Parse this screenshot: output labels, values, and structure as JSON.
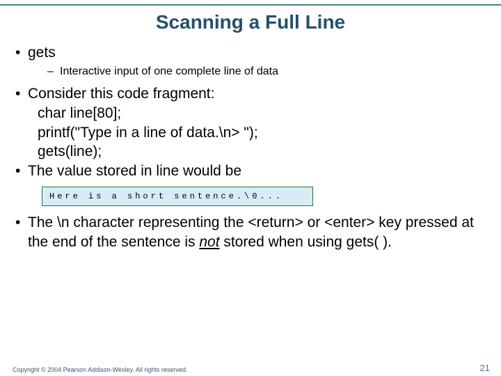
{
  "title": "Scanning a Full Line",
  "bullets": {
    "b1": "gets",
    "b1_sub": "Interactive input of one complete line of data",
    "b2": "Consider this code fragment:",
    "code1": "char line[80];",
    "code2": "printf(\"Type in a line of data.\\n> \");",
    "code3": "gets(line);",
    "b3": "The value stored in line would be",
    "memory": "Here is a short sentence.\\0...",
    "b4_pre": "The \\n character representing the <return> or <enter> key pressed at the end of the sentence is ",
    "b4_not": "not",
    "b4_post": " stored when using gets( )."
  },
  "footer": "Copyright © 2004 Pearson Addison-Wesley. All rights reserved.",
  "pagenum": "21"
}
